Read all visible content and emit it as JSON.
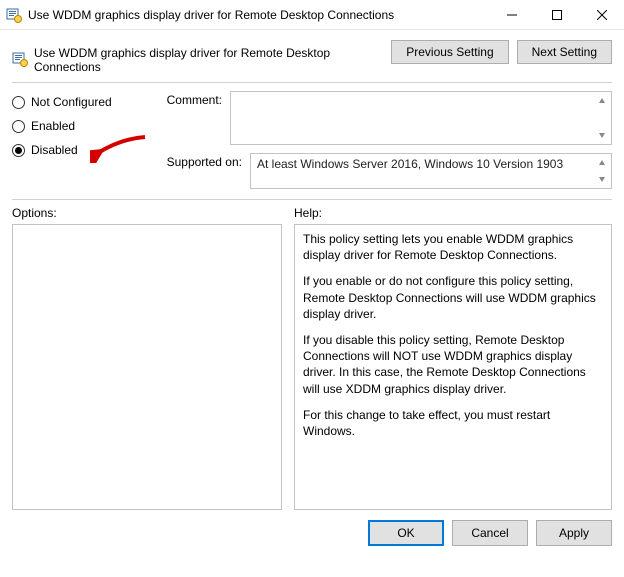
{
  "window": {
    "title": "Use WDDM graphics display driver for Remote Desktop Connections"
  },
  "header": {
    "policy_title": "Use WDDM graphics display driver for Remote Desktop Connections",
    "prev": "Previous Setting",
    "next": "Next Setting"
  },
  "radios": {
    "not_configured": "Not Configured",
    "enabled": "Enabled",
    "disabled": "Disabled",
    "selected": "disabled"
  },
  "fields": {
    "comment_label": "Comment:",
    "comment_value": "",
    "supported_label": "Supported on:",
    "supported_value": "At least Windows Server 2016, Windows 10 Version 1903"
  },
  "panels": {
    "options_label": "Options:",
    "help_label": "Help:",
    "help_p1": "This policy setting lets you enable WDDM graphics display driver for Remote Desktop Connections.",
    "help_p2": "If you enable or do not configure this policy setting, Remote Desktop Connections will use WDDM graphics display driver.",
    "help_p3": "If you disable this policy setting, Remote Desktop Connections will NOT use WDDM graphics display driver. In this case, the Remote Desktop Connections will use XDDM graphics display driver.",
    "help_p4": "For this change to take effect, you must restart Windows."
  },
  "footer": {
    "ok": "OK",
    "cancel": "Cancel",
    "apply": "Apply"
  }
}
